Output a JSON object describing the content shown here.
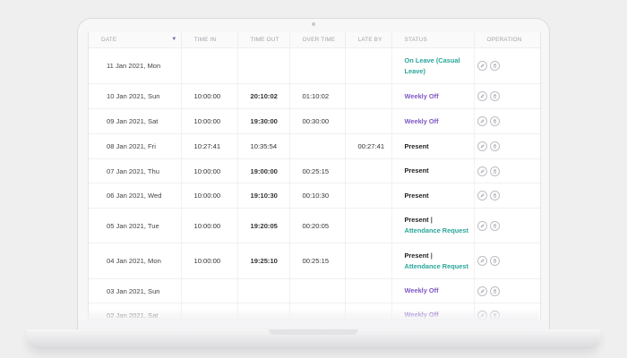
{
  "table": {
    "headers": {
      "date": "DATE",
      "time_in": "TIME IN",
      "time_out": "TIME OUT",
      "over_time": "OVER TIME",
      "late_by": "LATE BY",
      "status": "STATUS",
      "operation": "OPERATION"
    },
    "rows": [
      {
        "date": "11 Jan 2021, Mon",
        "time_in": "",
        "time_out": "",
        "over_time": "",
        "late_by": "",
        "status": "On Leave (Casual Leave)",
        "status_extra": ""
      },
      {
        "date": "10 Jan 2021, Sun",
        "time_in": "10:00:00",
        "time_out": "20:10:02",
        "over_time": "01:10:02",
        "late_by": "",
        "status": "Weekly Off",
        "status_extra": ""
      },
      {
        "date": "09 Jan 2021, Sat",
        "time_in": "10:00:00",
        "time_out": "19:30:00",
        "over_time": "00:30:00",
        "late_by": "",
        "status": "Weekly Off",
        "status_extra": ""
      },
      {
        "date": "08 Jan 2021, Fri",
        "time_in": "10:27:41",
        "time_out": "10:35:54",
        "over_time": "",
        "late_by": "00:27:41",
        "status": "Present",
        "status_extra": ""
      },
      {
        "date": "07 Jan 2021, Thu",
        "time_in": "10:00:00",
        "time_out": "19:00:00",
        "over_time": "00:25:15",
        "late_by": "",
        "status": "Present",
        "status_extra": ""
      },
      {
        "date": "06 Jan 2021, Wed",
        "time_in": "10:00:00",
        "time_out": "19:10:30",
        "over_time": "00:10:30",
        "late_by": "",
        "status": "Present",
        "status_extra": ""
      },
      {
        "date": "05 Jan 2021, Tue",
        "time_in": "10:00:00",
        "time_out": "19:20:05",
        "over_time": "00:20:05",
        "late_by": "",
        "status": "Present",
        "status_extra": "Attendance Request"
      },
      {
        "date": "04 Jan 2021, Mon",
        "time_in": "10:00:00",
        "time_out": "19:25:10",
        "over_time": "00:25:15",
        "late_by": "",
        "status": "Present",
        "status_extra": "Attendance Request"
      },
      {
        "date": "03 Jan 2021, Sun",
        "time_in": "",
        "time_out": "",
        "over_time": "",
        "late_by": "",
        "status": "Weekly Off",
        "status_extra": ""
      },
      {
        "date": "02 Jan 2021, Sat",
        "time_in": "",
        "time_out": "",
        "over_time": "",
        "late_by": "",
        "status": "Weekly Off",
        "status_extra": ""
      }
    ],
    "status_separator": "|"
  },
  "icons": {
    "sort": "triangle-down-icon",
    "edit": "pencil-icon",
    "delete": "trash-icon"
  },
  "colors": {
    "present": "#222222",
    "leave": "#2aa59a",
    "weekly_off": "#7e57c2",
    "request": "#2aa59a"
  }
}
